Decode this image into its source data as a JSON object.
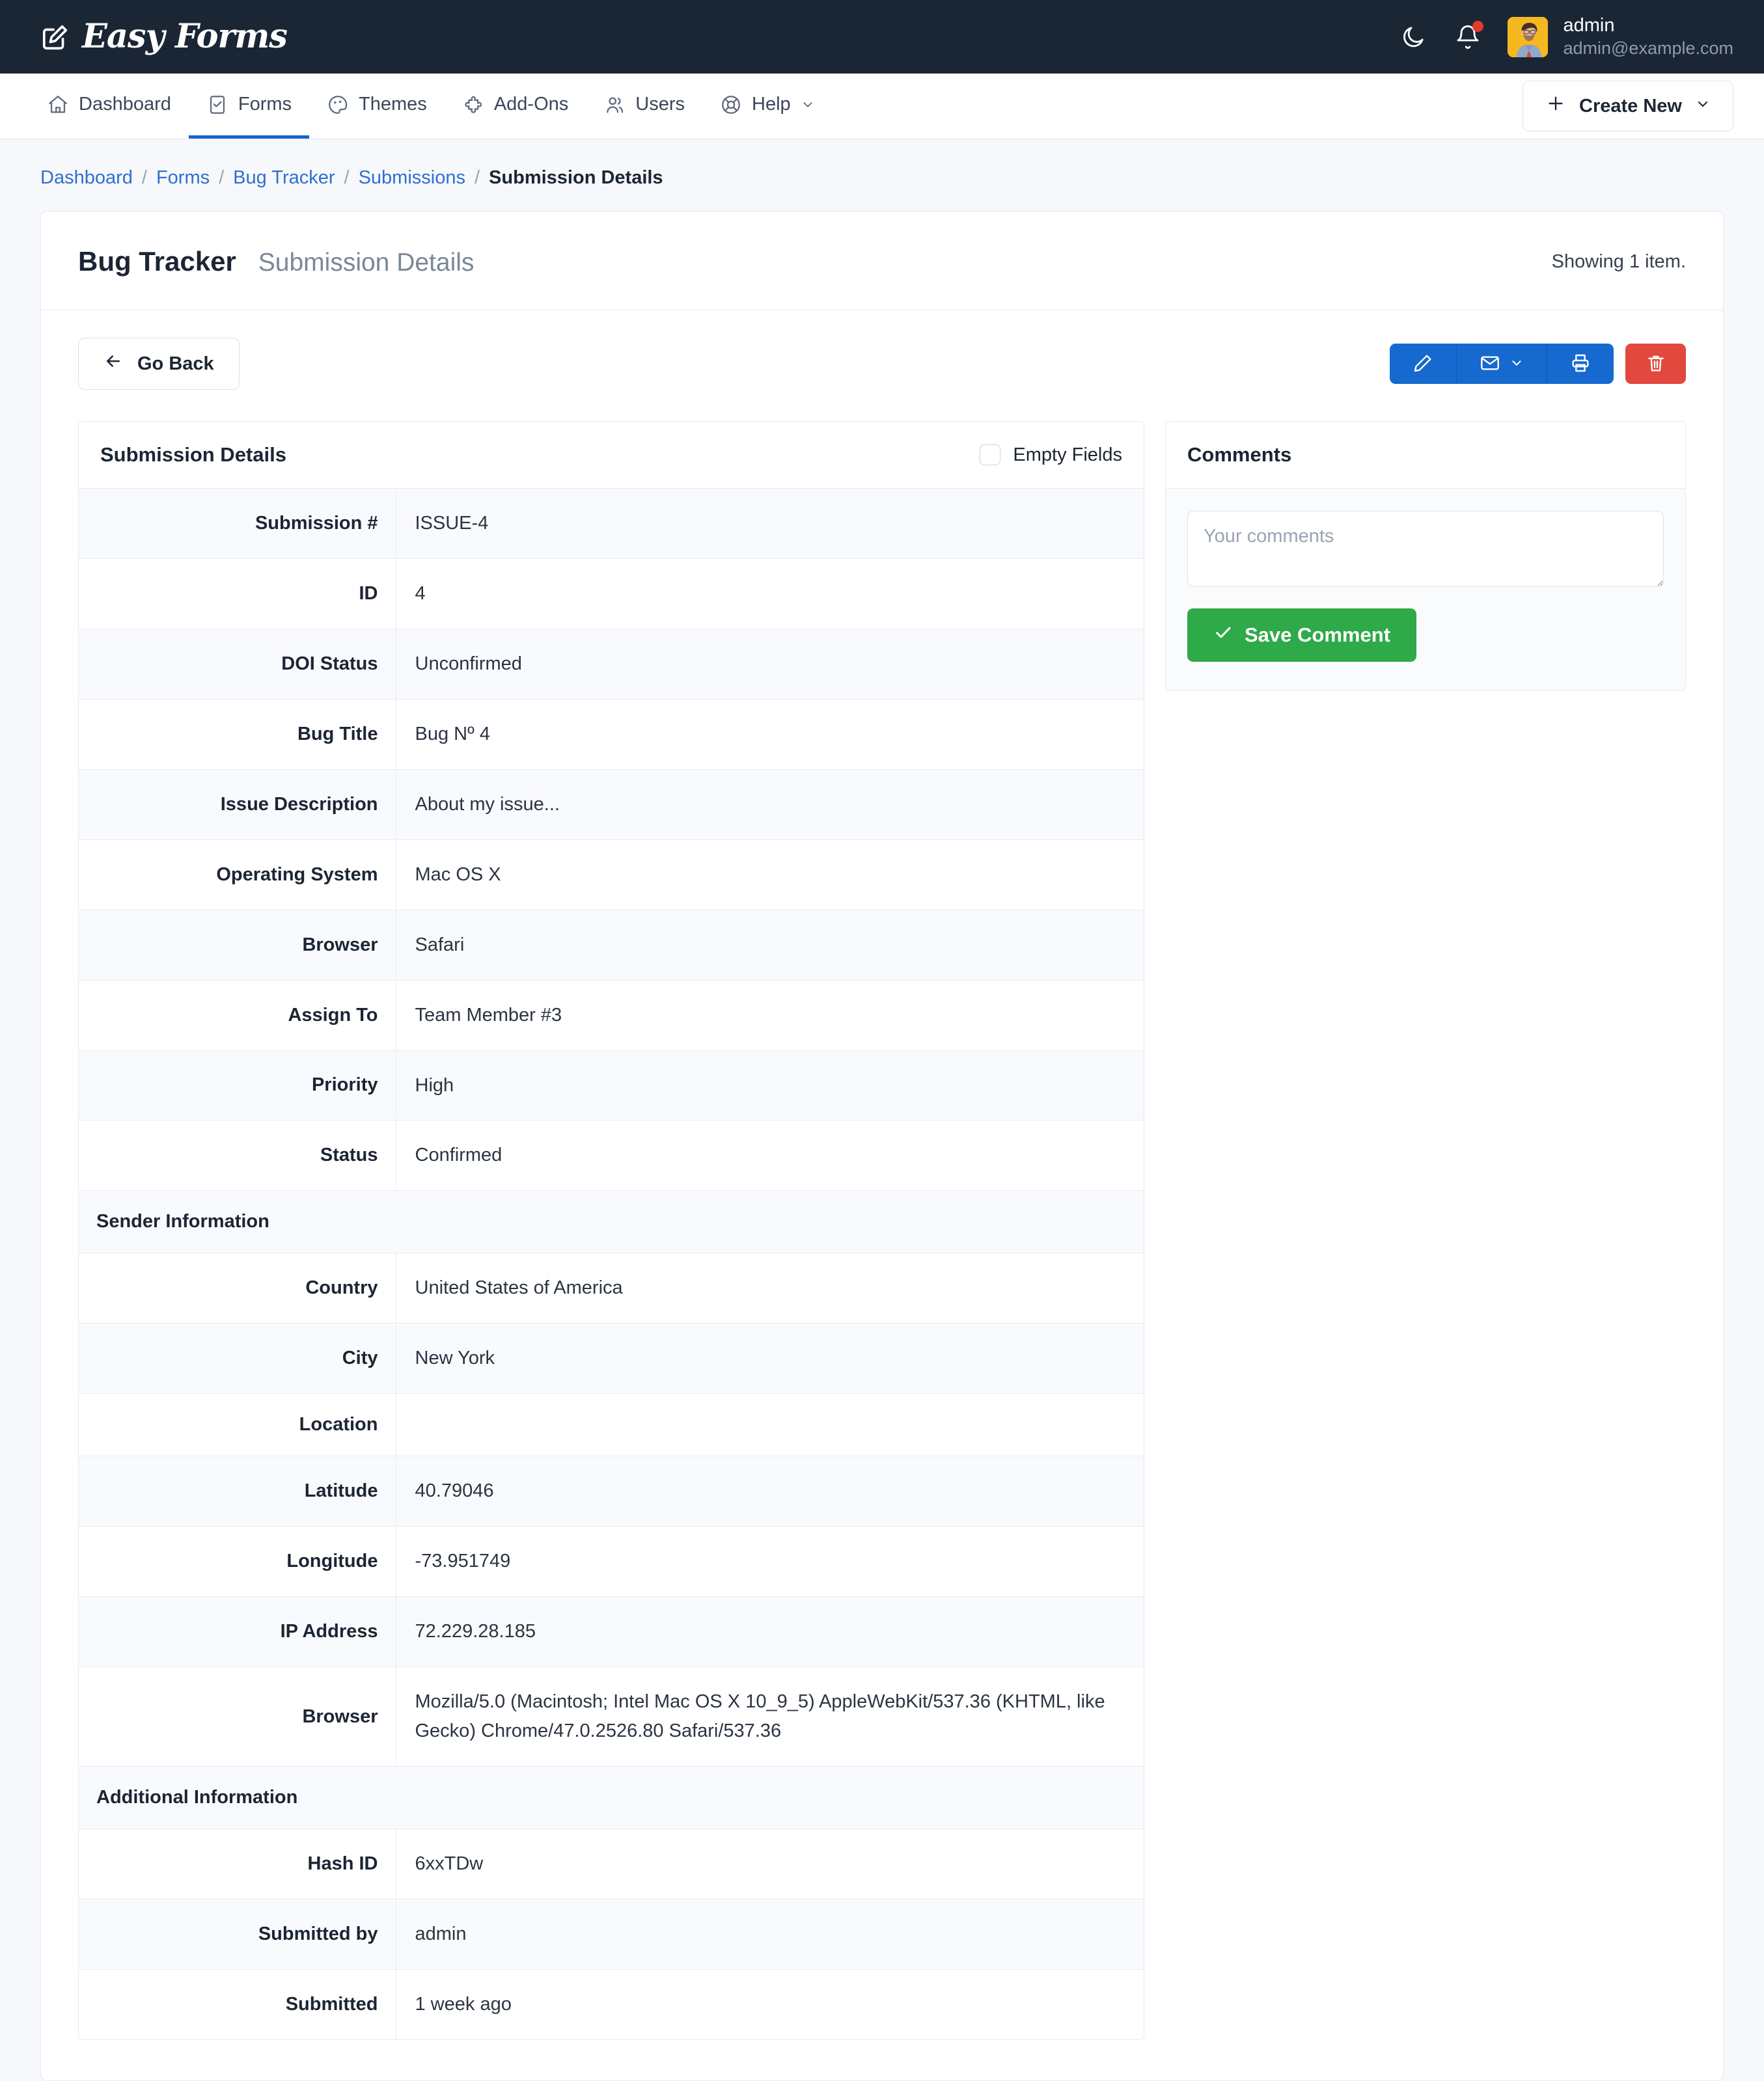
{
  "header": {
    "brand": "Easy Forms",
    "brand_icon": "pencil-square-icon",
    "dark_mode_icon": "moon-icon",
    "notifications_icon": "bell-icon",
    "user_name": "admin",
    "user_email": "admin@example.com"
  },
  "nav": {
    "items": [
      {
        "label": "Dashboard",
        "icon": "home-icon",
        "active": false
      },
      {
        "label": "Forms",
        "icon": "clipboard-check-icon",
        "active": true
      },
      {
        "label": "Themes",
        "icon": "palette-icon",
        "active": false
      },
      {
        "label": "Add-Ons",
        "icon": "puzzle-icon",
        "active": false
      },
      {
        "label": "Users",
        "icon": "users-icon",
        "active": false
      },
      {
        "label": "Help",
        "icon": "life-ring-icon",
        "active": false
      }
    ],
    "create_new": "Create New",
    "create_new_icon": "plus-icon",
    "create_new_caret": "chevron-down-icon"
  },
  "breadcrumb": {
    "items": [
      "Dashboard",
      "Forms",
      "Bug Tracker",
      "Submissions"
    ],
    "current": "Submission Details",
    "separator": "/"
  },
  "card": {
    "title": "Bug Tracker",
    "subtitle": "Submission Details",
    "count": "Showing 1 item."
  },
  "toolbar": {
    "back_label": "Go Back",
    "back_icon": "arrow-left-icon",
    "edit_icon": "pencil-icon",
    "email_icon": "envelope-icon",
    "email_caret_icon": "chevron-down-icon",
    "print_icon": "printer-icon",
    "delete_icon": "trash-icon"
  },
  "details": {
    "panel_title": "Submission Details",
    "empty_fields_label": "Empty Fields",
    "empty_fields_checked": false,
    "rows": [
      {
        "type": "field",
        "label": "Submission #",
        "value": "ISSUE-4"
      },
      {
        "type": "field",
        "label": "ID",
        "value": "4"
      },
      {
        "type": "field",
        "label": "DOI Status",
        "value": "Unconfirmed"
      },
      {
        "type": "field",
        "label": "Bug Title",
        "value": "Bug Nº 4"
      },
      {
        "type": "field",
        "label": "Issue Description",
        "value": "About my issue..."
      },
      {
        "type": "field",
        "label": "Operating System",
        "value": "Mac OS X"
      },
      {
        "type": "field",
        "label": "Browser",
        "value": "Safari"
      },
      {
        "type": "field",
        "label": "Assign To",
        "value": "Team Member #3"
      },
      {
        "type": "field",
        "label": "Priority",
        "value": "High"
      },
      {
        "type": "field",
        "label": "Status",
        "value": "Confirmed"
      },
      {
        "type": "section",
        "label": "Sender Information",
        "value": ""
      },
      {
        "type": "field",
        "label": "Country",
        "value": "United States of America"
      },
      {
        "type": "field",
        "label": "City",
        "value": "New York"
      },
      {
        "type": "field",
        "label": "Location",
        "value": ""
      },
      {
        "type": "field",
        "label": "Latitude",
        "value": "40.79046"
      },
      {
        "type": "field",
        "label": "Longitude",
        "value": "-73.951749"
      },
      {
        "type": "field",
        "label": "IP Address",
        "value": "72.229.28.185"
      },
      {
        "type": "field",
        "label": "Browser",
        "value": "Mozilla/5.0 (Macintosh; Intel Mac OS X 10_9_5) AppleWebKit/537.36 (KHTML, like Gecko) Chrome/47.0.2526.80 Safari/537.36"
      },
      {
        "type": "section",
        "label": "Additional Information",
        "value": ""
      },
      {
        "type": "field",
        "label": "Hash ID",
        "value": "6xxTDw"
      },
      {
        "type": "field",
        "label": "Submitted by",
        "value": "admin"
      },
      {
        "type": "field",
        "label": "Submitted",
        "value": "1 week ago"
      }
    ]
  },
  "comments": {
    "panel_title": "Comments",
    "placeholder": "Your comments",
    "value": "",
    "save_label": "Save Comment",
    "save_icon": "check-icon"
  },
  "colors": {
    "topbar_bg": "#1b2635",
    "accent_blue": "#1669ce",
    "link_blue": "#2f6fd0",
    "danger_red": "#e2483d",
    "success_green": "#2eaa48",
    "page_bg": "#f6f8fb",
    "stripe_bg": "#f8fafd"
  }
}
